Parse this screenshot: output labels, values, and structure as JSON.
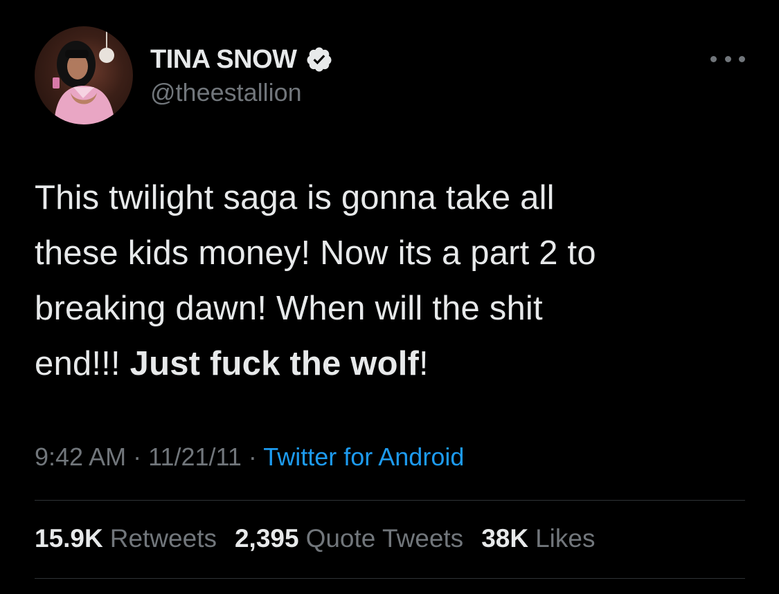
{
  "user": {
    "display_name": "TINA SNOW",
    "handle": "@theestallion",
    "verified": true,
    "avatar_icon": "profile-photo"
  },
  "tweet": {
    "text_lines": [
      "This twilight saga is gonna take all",
      "these kids money! Now its a part 2 to",
      "breaking dawn! When will the shit",
      "end!!! "
    ],
    "bold_text": "Just fuck the wolf",
    "trailing_text": "!"
  },
  "meta": {
    "time": "9:42 AM",
    "separator": " · ",
    "date": "11/21/11",
    "source": "Twitter for Android"
  },
  "stats": {
    "retweets_count": "15.9K",
    "retweets_label": "Retweets",
    "quotes_count": "2,395",
    "quotes_label": "Quote Tweets",
    "likes_count": "38K",
    "likes_label": "Likes"
  },
  "colors": {
    "background": "#000000",
    "primary_text": "#e7e9ea",
    "secondary_text": "#71767b",
    "link": "#1d9bf0",
    "divider": "#2f3336"
  }
}
